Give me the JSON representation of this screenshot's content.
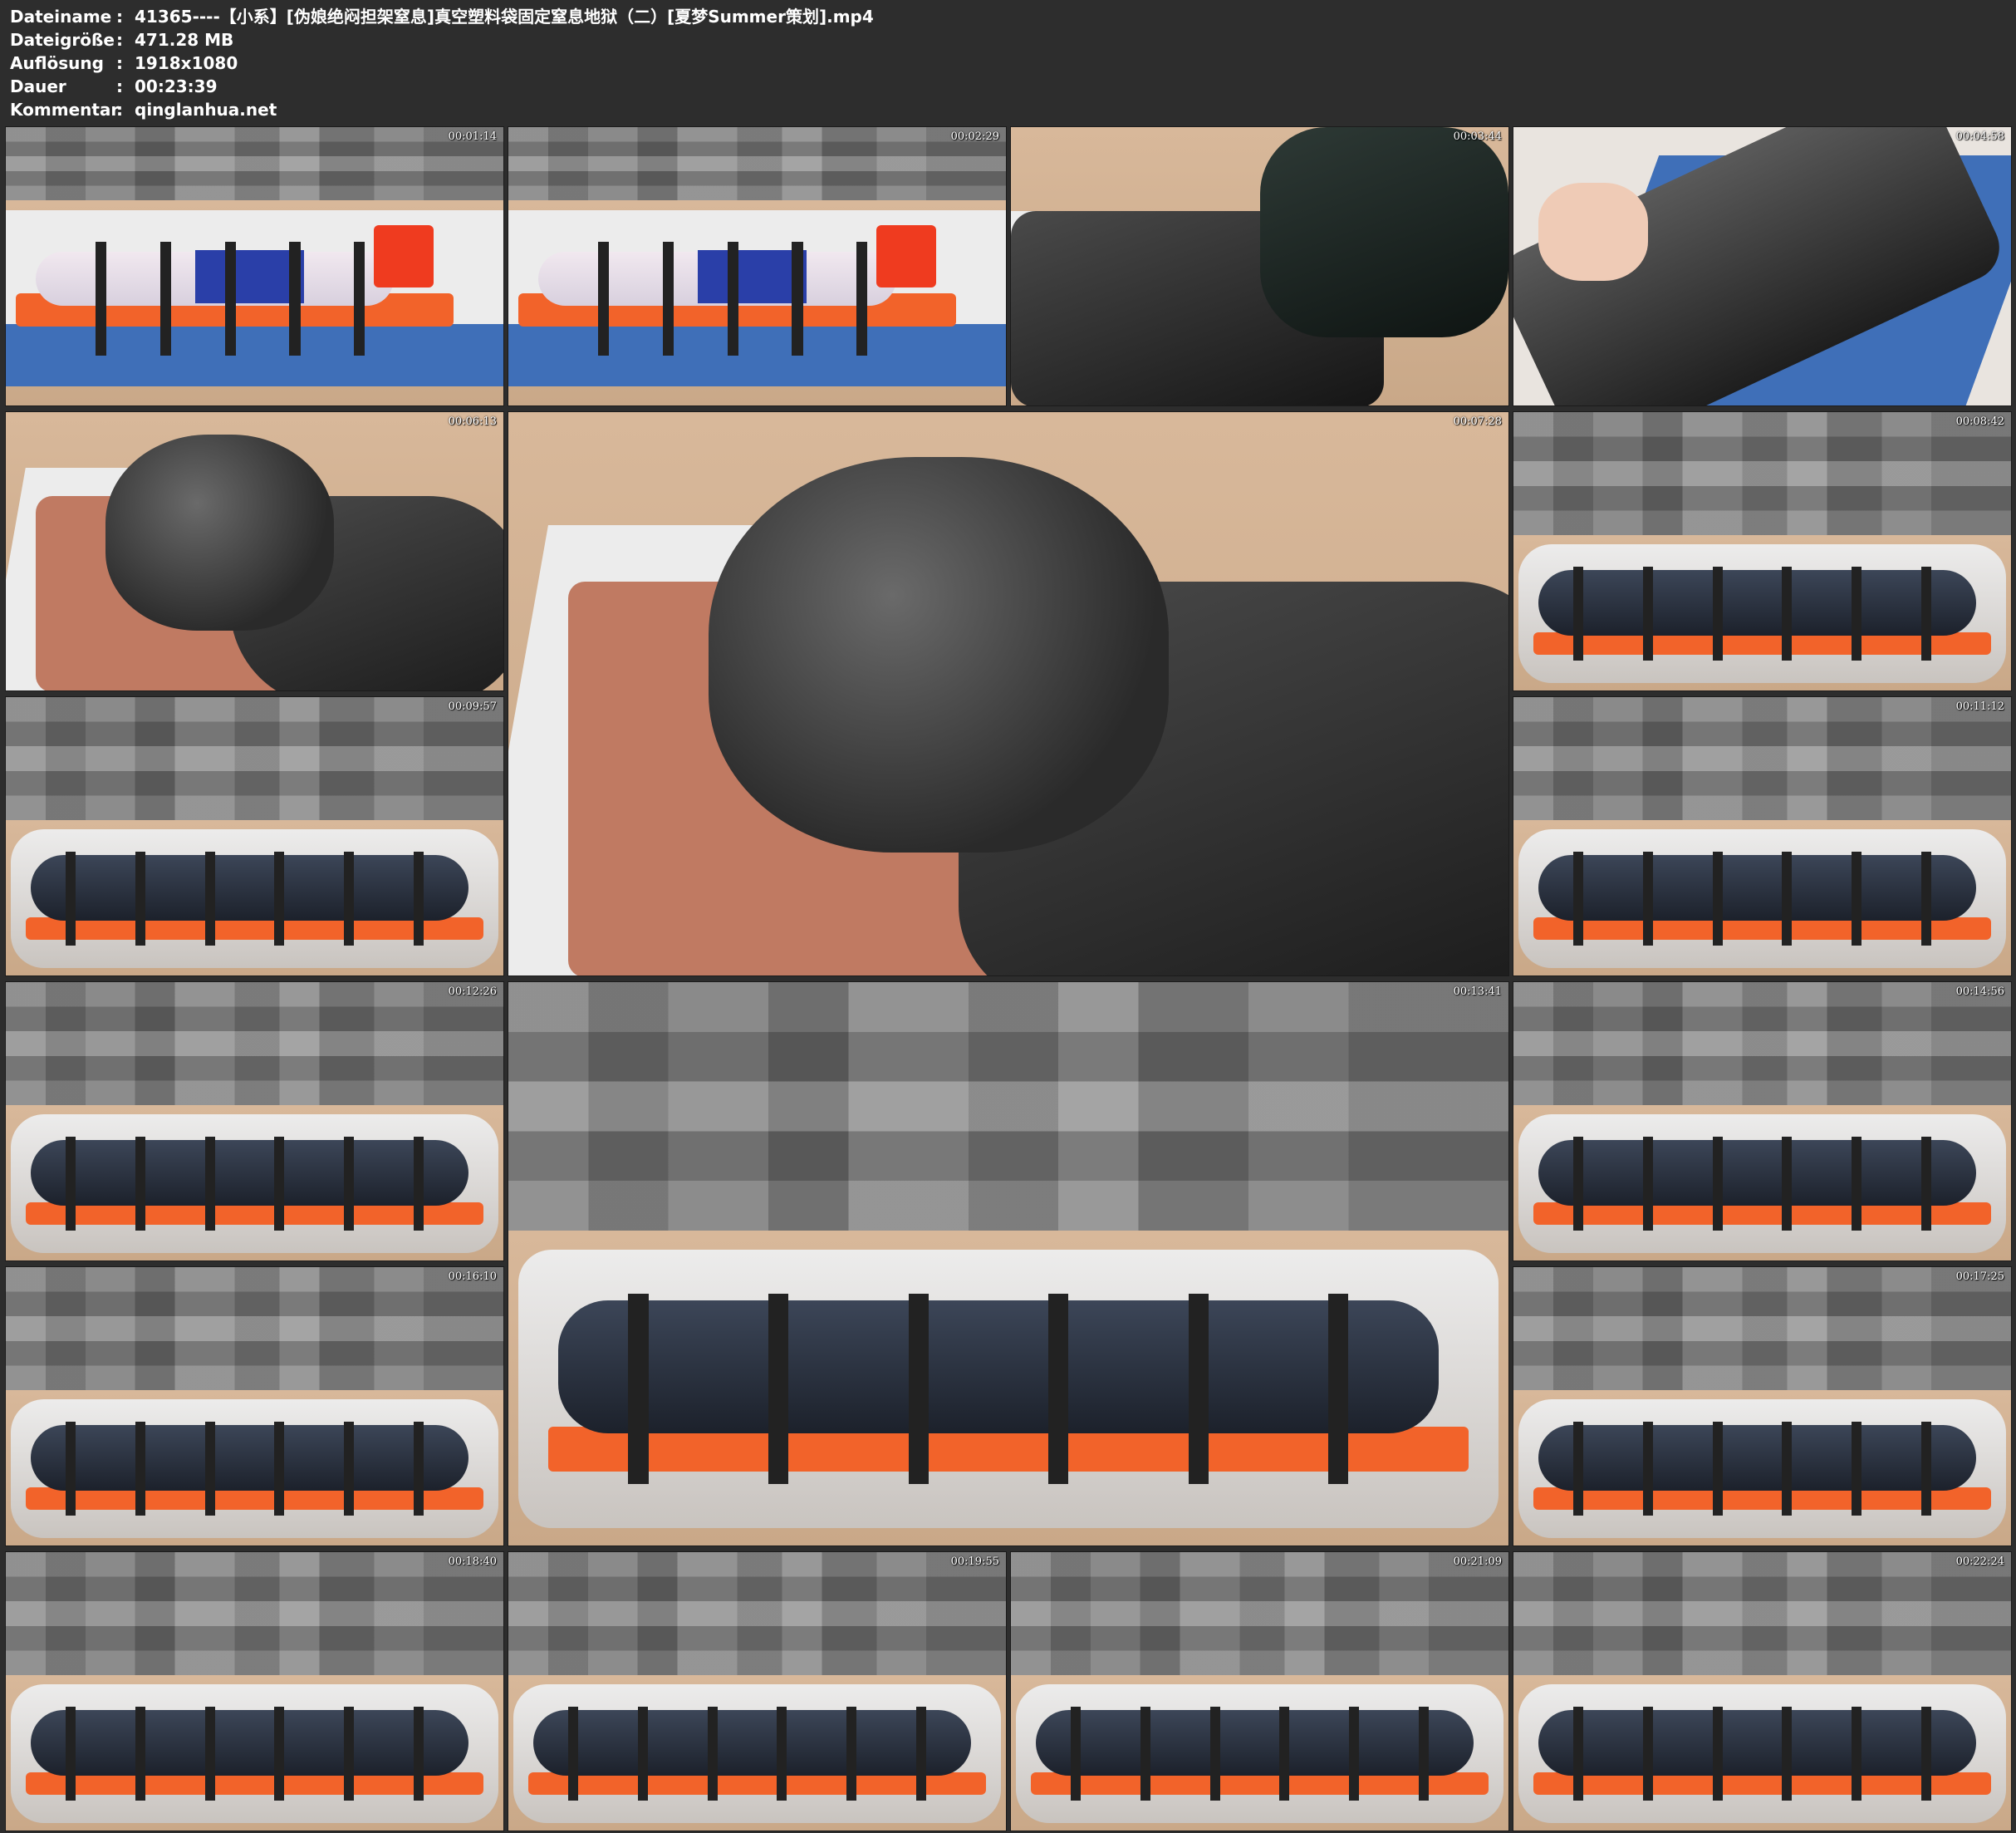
{
  "file_info": {
    "rows": [
      {
        "key": "Dateiname",
        "sep": ":",
        "value": "41365----【小系】[伪娘绝闷担架窒息]真空塑料袋固定窒息地狱（二）[夏梦Summer策划].mp4"
      },
      {
        "key": "Dateigröße",
        "sep": ":",
        "value": "471.28 MB"
      },
      {
        "key": "Auflösung",
        "sep": ":",
        "value": "1918x1080"
      },
      {
        "key": "Dauer",
        "sep": ":",
        "value": "00:23:39"
      },
      {
        "key": "Kommentar",
        "sep": ":",
        "value": "qinglanhua.net"
      }
    ]
  },
  "thumbnails": [
    {
      "timestamp": "00:01:14",
      "scene": "stretcher-strapped"
    },
    {
      "timestamp": "00:02:29",
      "scene": "stretcher-strapped"
    },
    {
      "timestamp": "00:03:44",
      "scene": "black-plastic"
    },
    {
      "timestamp": "00:04:58",
      "scene": "wrapped-on-blue-mat"
    },
    {
      "timestamp": "00:06:13",
      "scene": "latex-hood-cushion"
    },
    {
      "timestamp": "00:07:28",
      "scene": "latex-hood-cushion"
    },
    {
      "timestamp": "00:08:42",
      "scene": "clear-bag-stretcher"
    },
    {
      "timestamp": "00:09:57",
      "scene": "clear-bag-stretcher"
    },
    {
      "timestamp": "00:11:12",
      "scene": "clear-bag-stretcher"
    },
    {
      "timestamp": "00:12:26",
      "scene": "clear-bag-stretcher"
    },
    {
      "timestamp": "00:13:41",
      "scene": "clear-bag-stretcher"
    },
    {
      "timestamp": "00:14:56",
      "scene": "clear-bag-stretcher"
    },
    {
      "timestamp": "00:16:10",
      "scene": "clear-bag-stretcher"
    },
    {
      "timestamp": "00:17:25",
      "scene": "clear-bag-stretcher"
    },
    {
      "timestamp": "00:18:40",
      "scene": "clear-bag-stretcher"
    },
    {
      "timestamp": "00:19:55",
      "scene": "clear-bag-stretcher"
    },
    {
      "timestamp": "00:21:09",
      "scene": "clear-bag-stretcher"
    },
    {
      "timestamp": "00:22:24",
      "scene": "clear-bag-stretcher"
    }
  ]
}
